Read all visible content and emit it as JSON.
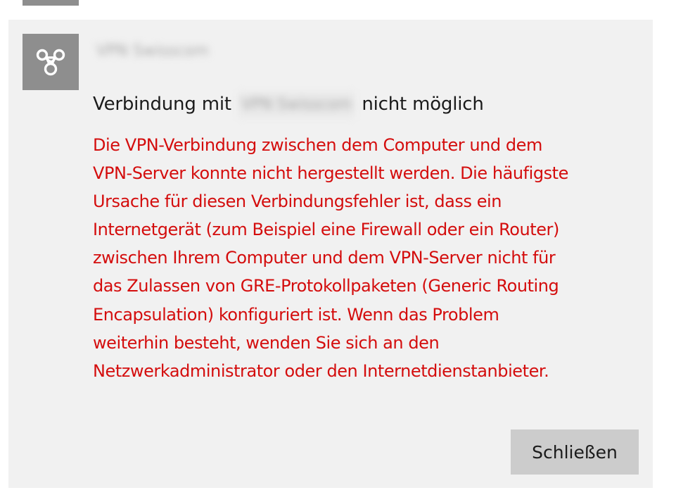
{
  "notification": {
    "app_name": "VPN Swisscom",
    "app_icon": "vpn-infinity-icon",
    "title_prefix": "Verbindung mit",
    "title_connection": "VPN Swisscom",
    "title_suffix": "nicht möglich",
    "message": "Die VPN-Verbindung zwischen dem Computer und dem\nVPN-Server konnte nicht hergestellt werden. Die häufigste\nUrsache für diesen Verbindungsfehler ist, dass ein\nInternetgerät (zum Beispiel eine Firewall oder ein Router)\nzwischen Ihrem Computer und dem VPN-Server nicht für\ndas Zulassen von GRE-Protokollpaketen (Generic Routing\nEncapsulation) konfiguriert ist. Wenn das Problem\nweiterhin besteht, wenden Sie sich an den\nNetzwerkadministrator oder den Internetdienstanbieter.",
    "close_label": "Schließen"
  },
  "colors": {
    "panel_background": "#f1f1f1",
    "icon_tile": "#8e8e8e",
    "error_text": "#d40d0d",
    "button_background": "#cccccc"
  }
}
